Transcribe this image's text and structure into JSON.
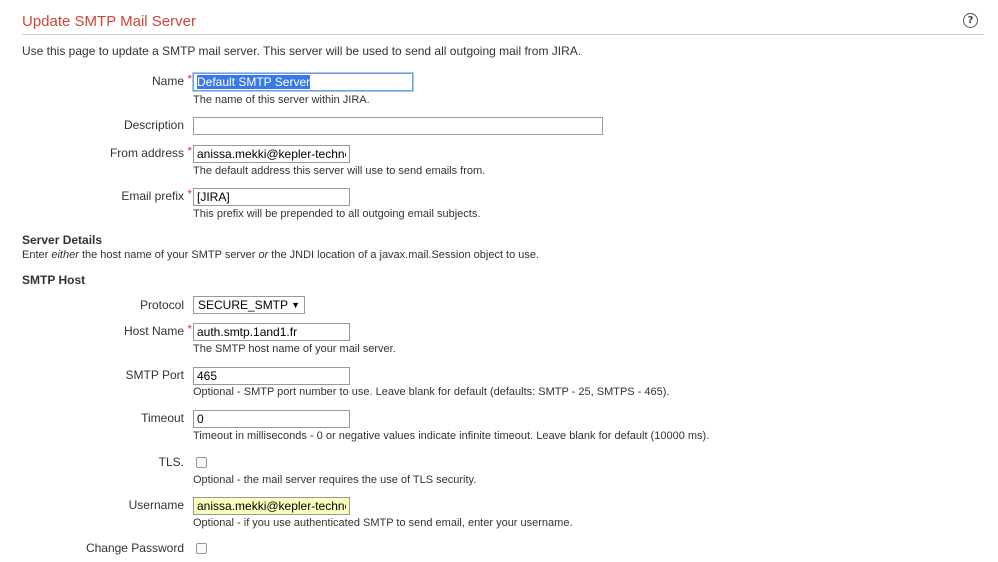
{
  "page": {
    "title": "Update SMTP Mail Server",
    "intro": "Use this page to update a SMTP mail server. This server will be used to send all outgoing mail from JIRA."
  },
  "help_icon": "help-icon",
  "required_marker": "*",
  "form": {
    "name": {
      "label": "Name",
      "value": "Default SMTP Server",
      "hint": "The name of this server within JIRA."
    },
    "description": {
      "label": "Description",
      "value": ""
    },
    "from_address": {
      "label": "From address",
      "value": "anissa.mekki@kepler-technc",
      "hint": "The default address this server will use to send emails from."
    },
    "email_prefix": {
      "label": "Email prefix",
      "value": "[JIRA]",
      "hint": "This prefix will be prepended to all outgoing email subjects."
    }
  },
  "server_details": {
    "heading": "Server Details",
    "desc_parts": [
      "Enter ",
      "either",
      " the host name of your SMTP server ",
      "or",
      " the JNDI location of a javax.mail.Session object to use."
    ]
  },
  "smtp_host": {
    "heading": "SMTP Host",
    "protocol": {
      "label": "Protocol",
      "value": "SECURE_SMTP",
      "caret": "▼"
    },
    "host_name": {
      "label": "Host Name",
      "value": "auth.smtp.1and1.fr",
      "hint": "The SMTP host name of your mail server."
    },
    "port": {
      "label": "SMTP Port",
      "value": "465",
      "hint": "Optional - SMTP port number to use. Leave blank for default (defaults: SMTP - 25, SMTPS - 465)."
    },
    "timeout": {
      "label": "Timeout",
      "value": "0",
      "hint": "Timeout in milliseconds - 0 or negative values indicate infinite timeout. Leave blank for default (10000 ms)."
    },
    "tls": {
      "label": "TLS.",
      "checked": false,
      "hint": "Optional - the mail server requires the use of TLS security."
    },
    "username": {
      "label": "Username",
      "value": "anissa.mekki@kepler-technc",
      "hint": "Optional - if you use authenticated SMTP to send email, enter your username."
    },
    "change_password": {
      "label": "Change Password",
      "checked": false
    }
  },
  "colors": {
    "title": "#d04437",
    "required": "#d04437",
    "autofill": "#faffbd",
    "selection": "#3b78e7"
  }
}
